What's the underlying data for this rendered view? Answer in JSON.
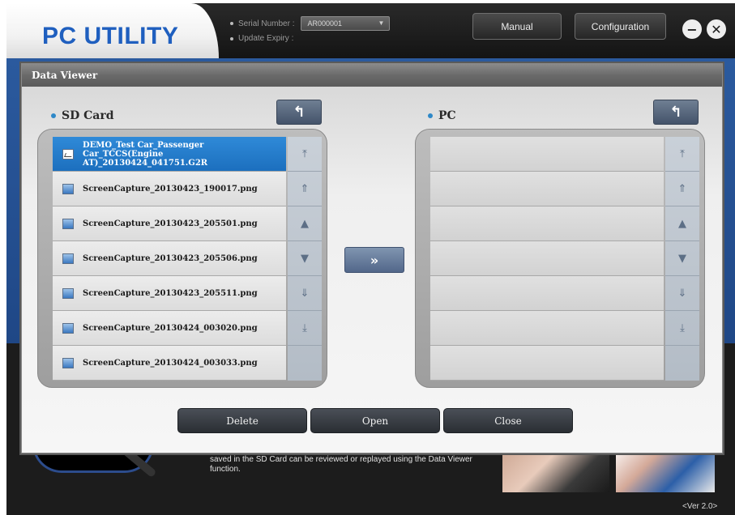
{
  "app": {
    "logo": "PC UTILITY",
    "serial_label": "Serial Number :",
    "serial_value": "AR000001",
    "update_label": "Update Expiry :",
    "manual_label": "Manual",
    "config_label": "Configuration",
    "minimize_symbol": "−",
    "close_symbol": "✕",
    "background_text": "saved in the SD Card can be reviewed or replayed using the Data Viewer function.",
    "version": "<Ver 2.0>"
  },
  "dialog": {
    "title": "Data Viewer",
    "sd_label": "SD Card",
    "pc_label": "PC",
    "up_symbol": "↰",
    "transfer_symbol": "»",
    "sd_files": [
      {
        "name": "DEMO_Test Car_Passenger Car_TCCS(Engine AT)_20130424_041751.G2R",
        "selected": true,
        "icon": "chart-file-icon"
      },
      {
        "name": "ScreenCapture_20130423_190017.png",
        "selected": false,
        "icon": "image-file-icon"
      },
      {
        "name": "ScreenCapture_20130423_205501.png",
        "selected": false,
        "icon": "image-file-icon"
      },
      {
        "name": "ScreenCapture_20130423_205506.png",
        "selected": false,
        "icon": "image-file-icon"
      },
      {
        "name": "ScreenCapture_20130423_205511.png",
        "selected": false,
        "icon": "image-file-icon"
      },
      {
        "name": "ScreenCapture_20130424_003020.png",
        "selected": false,
        "icon": "image-file-icon"
      },
      {
        "name": "ScreenCapture_20130424_003033.png",
        "selected": false,
        "icon": "image-file-icon"
      }
    ],
    "scroll_buttons": [
      {
        "symbol": "⤒",
        "name": "scroll-top-button"
      },
      {
        "symbol": "⇑",
        "name": "scroll-page-up-button"
      },
      {
        "symbol": "▲",
        "name": "scroll-up-button"
      },
      {
        "symbol": "▼",
        "name": "scroll-down-button"
      },
      {
        "symbol": "⇓",
        "name": "scroll-page-down-button"
      },
      {
        "symbol": "⤓",
        "name": "scroll-bottom-button"
      }
    ],
    "delete_label": "Delete",
    "open_label": "Open",
    "close_label": "Close"
  }
}
